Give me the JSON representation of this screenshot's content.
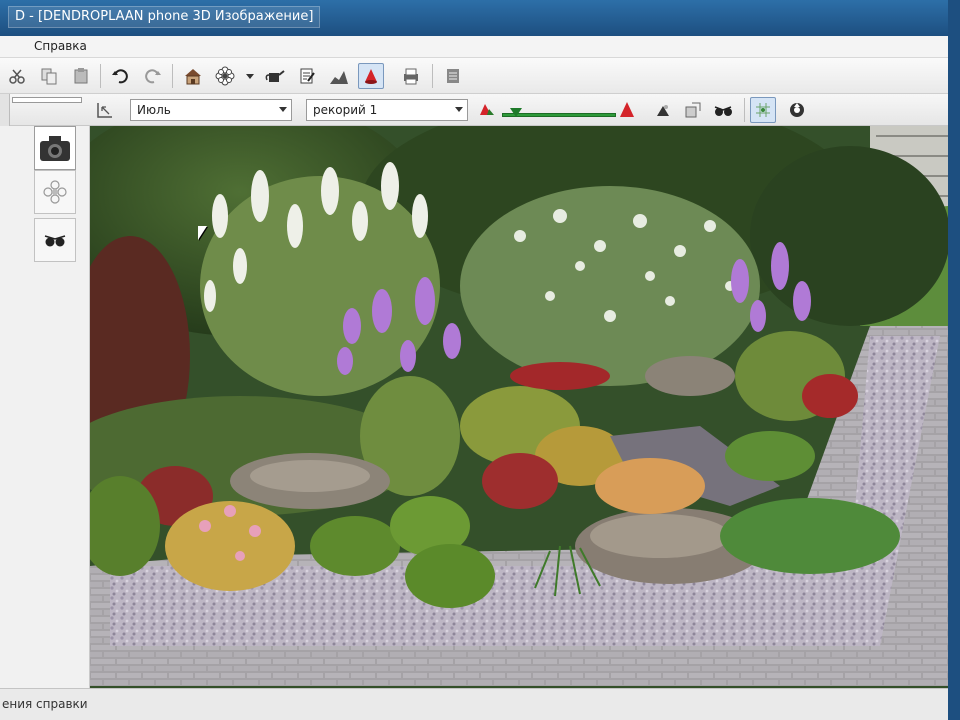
{
  "window": {
    "title": "D - [DENDROPLAAN phone 3D Изображение]"
  },
  "menu": {
    "items": [
      {
        "label": "Справка"
      }
    ]
  },
  "toolbar": {
    "month_select": {
      "value": "Июль"
    },
    "scenario_select": {
      "value": "рекорий 1"
    }
  },
  "status": {
    "text": "ения справки"
  },
  "colors": {
    "titlebar": "#1d4f80",
    "slider": "#2e9a3a",
    "accent_red": "#d4242a"
  }
}
